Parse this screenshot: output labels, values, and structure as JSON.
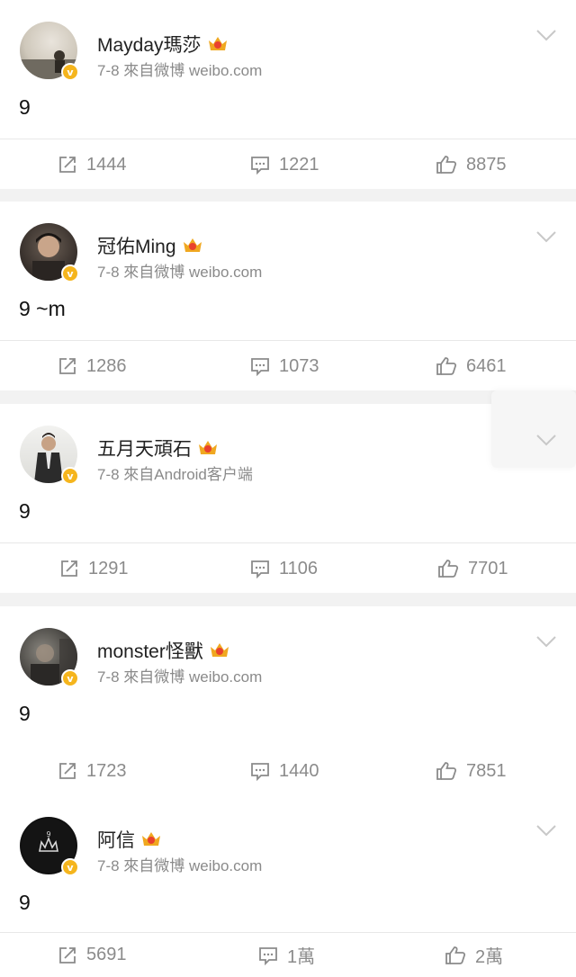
{
  "posts": [
    {
      "username": "Mayday瑪莎",
      "meta": "7-8  來自微博 weibo.com",
      "content": "9",
      "repost_count": "1444",
      "comment_count": "1221",
      "like_count": "8875"
    },
    {
      "username": "冠佑Ming",
      "meta": "7-8  來自微博 weibo.com",
      "content": "9 ~m",
      "repost_count": "1286",
      "comment_count": "1073",
      "like_count": "6461"
    },
    {
      "username": "五月天頑石",
      "meta": "7-8  來自Android客户端",
      "content": "9",
      "repost_count": "1291",
      "comment_count": "1106",
      "like_count": "7701"
    },
    {
      "username": "monster怪獸",
      "meta": "7-8  來自微博 weibo.com",
      "content": "9",
      "repost_count": "1723",
      "comment_count": "1440",
      "like_count": "7851"
    },
    {
      "username": "阿信",
      "meta": "7-8  來自微博 weibo.com",
      "content": "9",
      "repost_count": "5691",
      "comment_count": "1萬",
      "like_count": "2萬"
    }
  ],
  "icons": {
    "verified": "verified-badge-icon",
    "crown": "vip-crown-icon",
    "chevron": "chevron-down-icon",
    "repost": "repost-icon",
    "comment": "comment-icon",
    "like": "like-icon"
  },
  "colors": {
    "verified_badge": "#f5b51d",
    "crown": "#f0a820",
    "meta_text": "#8a8a8a",
    "action_text": "#8b8b8b",
    "background": "#f2f2f2"
  },
  "badges": {
    "verified_mark": "v"
  }
}
